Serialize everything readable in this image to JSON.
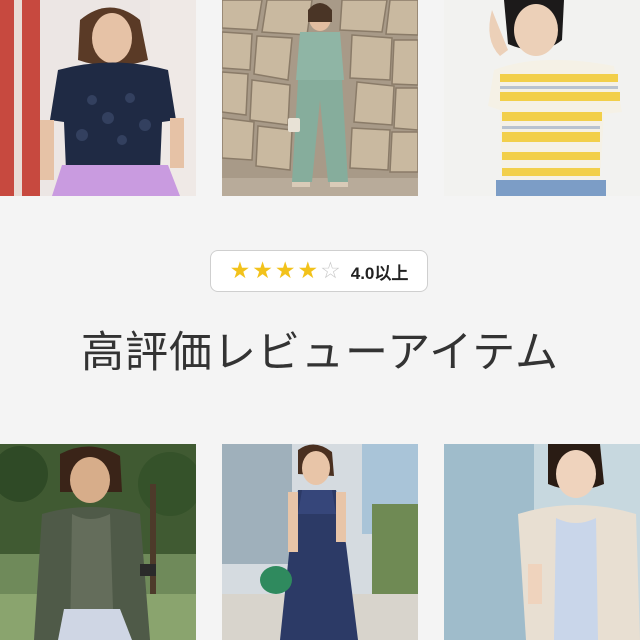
{
  "rating": {
    "stars_filled": 4,
    "stars_total": 5,
    "star_color": "#f2c21b",
    "label": "4.0以上"
  },
  "headline": "高評価レビューアイテム",
  "photos": [
    {
      "id": "p1",
      "subject": "woman in navy lace blouse and lavender skirt"
    },
    {
      "id": "p2",
      "subject": "woman in sage green set in front of stone wall"
    },
    {
      "id": "p3",
      "subject": "woman in yellow striped t-shirt"
    },
    {
      "id": "p4",
      "subject": "woman in khaki cardigan outdoors"
    },
    {
      "id": "p5",
      "subject": "woman in navy sleeveless maxi dress"
    },
    {
      "id": "p6",
      "subject": "woman in beige short-sleeve cardigan"
    }
  ]
}
